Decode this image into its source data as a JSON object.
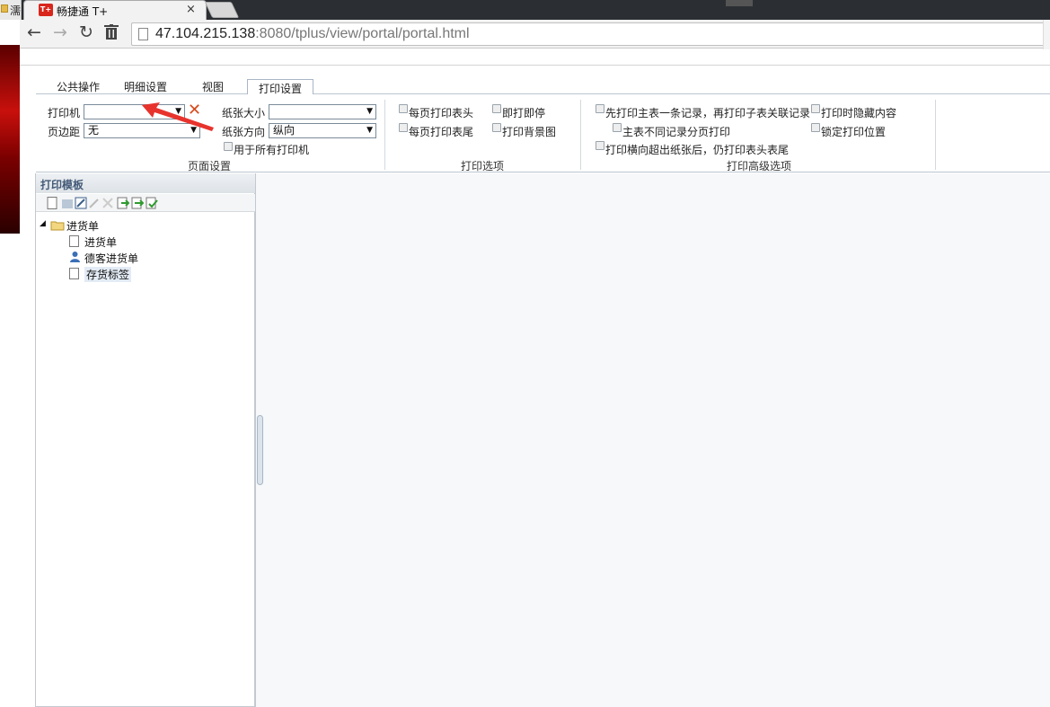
{
  "browser": {
    "prev_tab_label": "濡",
    "active_tab": {
      "logo": "T+",
      "title": "畅捷通 T+",
      "close": "×"
    },
    "address": {
      "host": "47.104.215.138",
      "rest": ":8080/tplus/view/portal/portal.html"
    },
    "nav": {
      "back": "←",
      "forward": "→",
      "reload": "↻",
      "trash": "🗑"
    }
  },
  "ribbon": {
    "tabs": [
      "公共操作",
      "明细设置",
      "视图",
      "打印设置"
    ],
    "active_tab_index": 3,
    "page_setup": {
      "printer_label": "打印机",
      "printer_value": "",
      "margin_label": "页边距",
      "margin_value": "无",
      "paper_size_label": "纸张大小",
      "paper_size_value": "",
      "orientation_label": "纸张方向",
      "orientation_value": "纵向",
      "all_printers_label": "用于所有打印机",
      "group_label": "页面设置"
    },
    "print_options": {
      "header_each_page": "每页打印表头",
      "footer_each_page": "每页打印表尾",
      "print_stop": "即打即停",
      "print_background": "打印背景图",
      "group_label": "打印选项"
    },
    "advanced": {
      "main_first": "先打印主表一条记录，再打印子表关联记录",
      "page_by_main": "主表不同记录分页打印",
      "horizontal_overflow": "打印横向超出纸张后，仍打印表头表尾",
      "hide_content": "打印时隐藏内容",
      "lock_position": "锁定打印位置",
      "group_label": "打印高级选项"
    }
  },
  "template_panel": {
    "title": "打印模板",
    "tree": {
      "root": "进货单",
      "children": [
        "进货单",
        "德客进货单",
        "存货标签"
      ]
    }
  },
  "colors": {
    "annotation_arrow": "#e8332d",
    "panel_title": "#445a78"
  }
}
